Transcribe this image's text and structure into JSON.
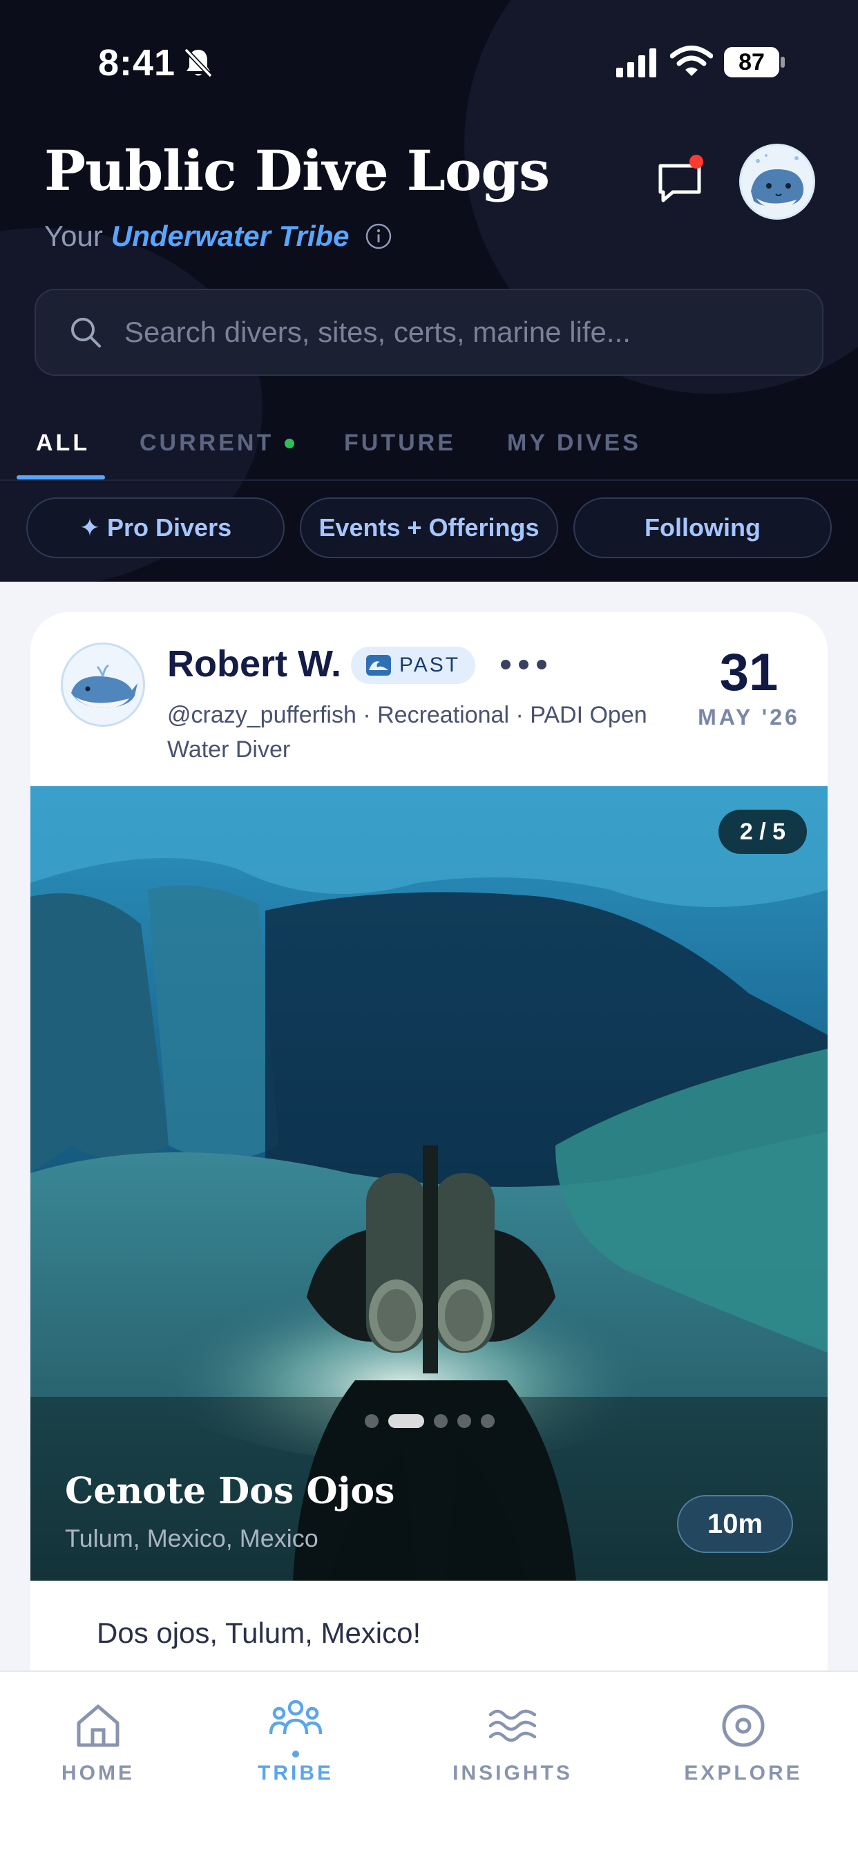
{
  "status_bar": {
    "time": "8:41",
    "battery": "87"
  },
  "header": {
    "title": "Public Dive Logs",
    "subtitle_prefix": "Your",
    "subtitle_highlight": "Underwater Tribe",
    "notification_badge": true
  },
  "search": {
    "placeholder": "Search divers, sites, certs, marine life..."
  },
  "tabs": [
    {
      "label": "ALL",
      "active": true
    },
    {
      "label": "CURRENT",
      "active": false,
      "live_dot_color": "#2fbf5a"
    },
    {
      "label": "FUTURE",
      "active": false
    },
    {
      "label": "MY DIVES",
      "active": false
    }
  ],
  "filters": [
    {
      "label": "✦ Pro Divers"
    },
    {
      "label": "Events + Offerings"
    },
    {
      "label": "Following"
    }
  ],
  "post": {
    "author": "Robert W.",
    "badge": "PAST",
    "handle_line": "@crazy_pufferfish · Recreational · PADI Open Water Diver",
    "date_day": "31",
    "date_month": "MAY '26",
    "photo_counter": "2 / 5",
    "photo_index": 2,
    "photo_total": 5,
    "site_name": "Cenote Dos Ojos",
    "site_location": "Tulum, Mexico, Mexico",
    "duration": "10m",
    "text": "Dos ojos, Tulum, Mexico!"
  },
  "bottom_nav": [
    {
      "label": "HOME",
      "icon": "home-icon",
      "active": false
    },
    {
      "label": "TRIBE",
      "icon": "people-icon",
      "active": true
    },
    {
      "label": "INSIGHTS",
      "icon": "waves-icon",
      "active": false
    },
    {
      "label": "EXPLORE",
      "icon": "target-icon",
      "active": false
    }
  ],
  "colors": {
    "header_bg": "#0b0d1b",
    "accent": "#58a6ff",
    "title_text": "#141c46",
    "nav_active": "#5ba6ea",
    "notification": "#ff3b30"
  }
}
